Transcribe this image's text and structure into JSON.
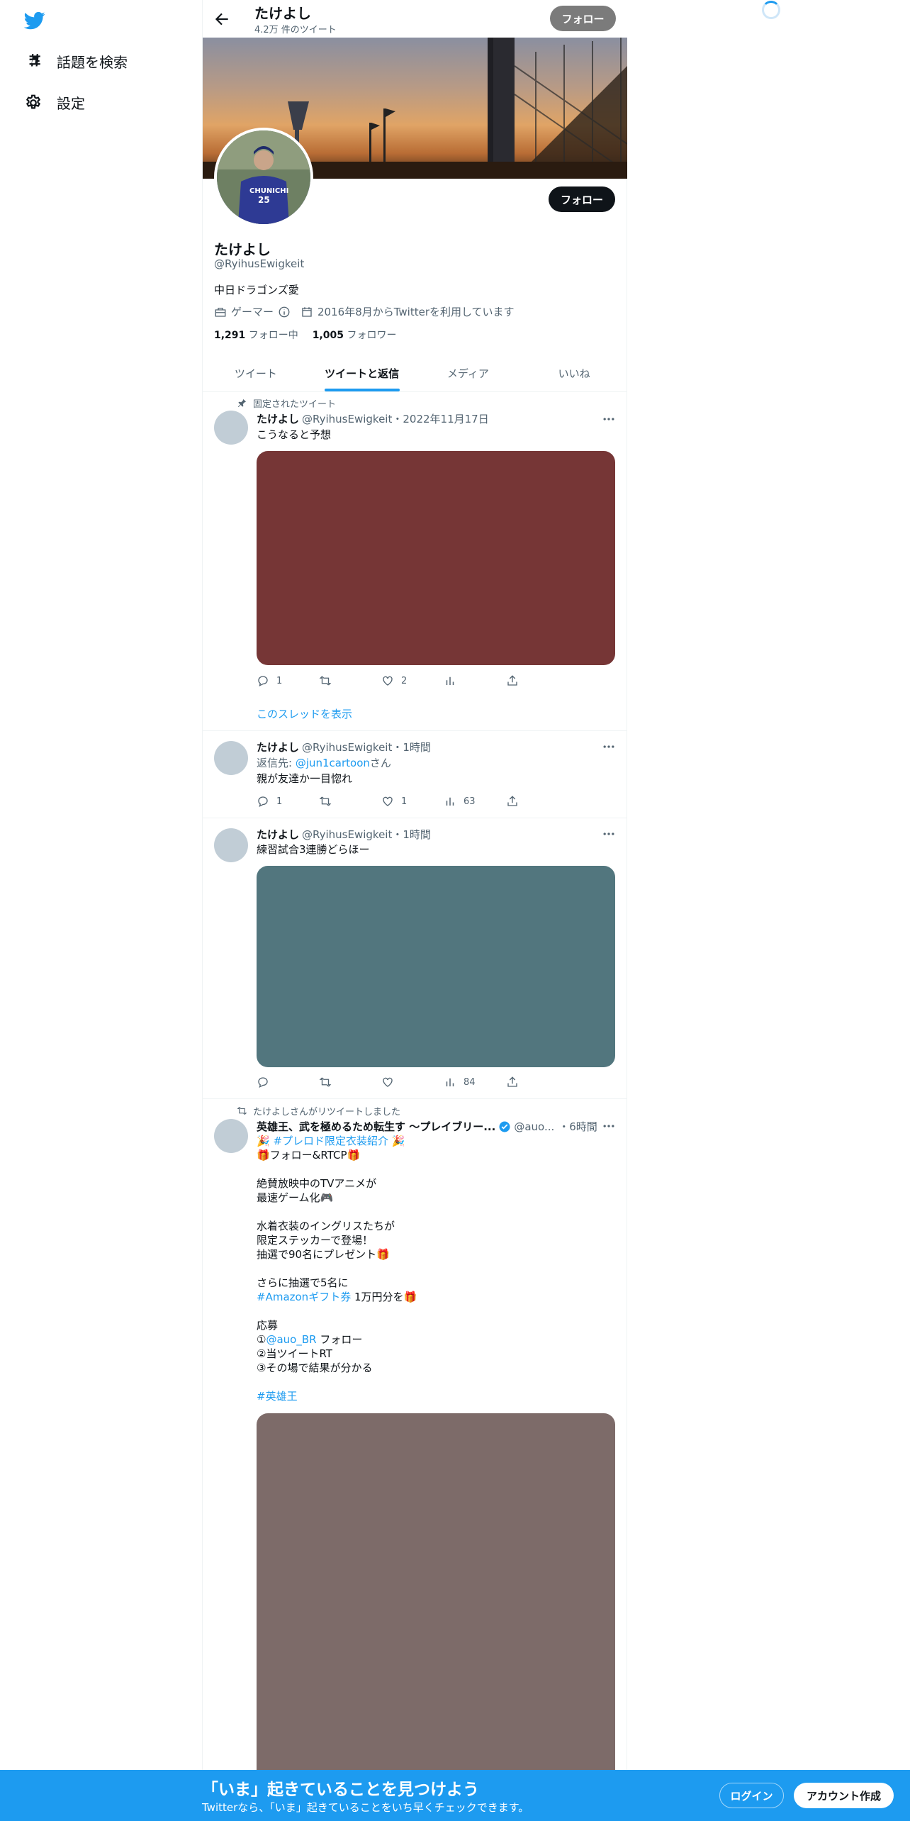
{
  "sidebar": {
    "logo_icon": "twitter-bird-icon",
    "items": [
      {
        "label": "話題を検索",
        "icon": "hashtag-icon"
      },
      {
        "label": "設定",
        "icon": "gear-icon"
      }
    ]
  },
  "topbar": {
    "name": "たけよし",
    "tweet_count": "4.2万 件のツイート",
    "follow_label": "フォロー"
  },
  "profile": {
    "follow_label": "フォロー",
    "name": "たけよし",
    "handle": "@RyihusEwigkeit",
    "bio": "中日ドラゴンズ愛",
    "category": "ゲーマー",
    "joined": "2016年8月からTwitterを利用しています",
    "following_count": "1,291",
    "following_label": "フォロー中",
    "followers_count": "1,005",
    "followers_label": "フォロワー"
  },
  "tabs": [
    "ツイート",
    "ツイートと返信",
    "メディア",
    "いいね"
  ],
  "active_tab": 1,
  "tweets": [
    {
      "context": "固定されたツイート",
      "name": "たけよし",
      "handle": "@RyihusEwigkeit",
      "time": "・2022年11月17日",
      "text": "こうなると予想",
      "image_color": "#763636",
      "replies": "1",
      "retweets": "",
      "likes": "2",
      "views": "",
      "thread_link": "このスレッドを表示"
    },
    {
      "name": "たけよし",
      "handle": "@RyihusEwigkeit",
      "time": "・1時間",
      "reply_to_label": "返信先: ",
      "reply_to_handle": "@jun1cartoon",
      "reply_to_suffix": "さん",
      "text": "親が友達か一目惚れ",
      "replies": "1",
      "retweets": "",
      "likes": "1",
      "views": "63"
    },
    {
      "name": "たけよし",
      "handle": "@RyihusEwigkeit",
      "time": "・1時間",
      "text": "練習試合3連勝どらほー",
      "image_color": "#52767e",
      "replies": "",
      "retweets": "",
      "likes": "",
      "views": "84"
    },
    {
      "context": "たけよしさんがリツイートしました",
      "name": "英雄王、武を極めるため転生す ～プレイブリー...",
      "handle": "@auo...",
      "time": "・6時間",
      "line1_emoji": "🎉",
      "line1_hashtag": "#プレロド限定衣装紹介",
      "line2": "🎁フォロー&RTCP🎁",
      "body1": "絶賛放映中のTVアニメが\n最速ゲーム化🎮",
      "body2": "水着衣装のイングリスたちが\n限定ステッカーで登場！\n抽選で90名にプレゼント🎁",
      "body3_pre": "さらに抽選で5名に",
      "body3_hashtag": "#Amazonギフト券",
      "body3_post": " 1万円分を🎁",
      "apply_label": "応募",
      "apply1_pre": "①",
      "apply1_handle": "@auo_BR",
      "apply1_post": " フォロー",
      "apply2": "②当ツイートRT",
      "apply3": "③その場で結果が分かる",
      "hashtag_end": "#英雄王",
      "image_color": "#7d6b69"
    }
  ],
  "bottom_bar": {
    "title": "「いま」起きていることを見つけよう",
    "subtitle": "Twitterなら、「いま」起きていることをいち早くチェックできます。",
    "login_label": "ログイン",
    "signup_label": "アカウント作成"
  }
}
